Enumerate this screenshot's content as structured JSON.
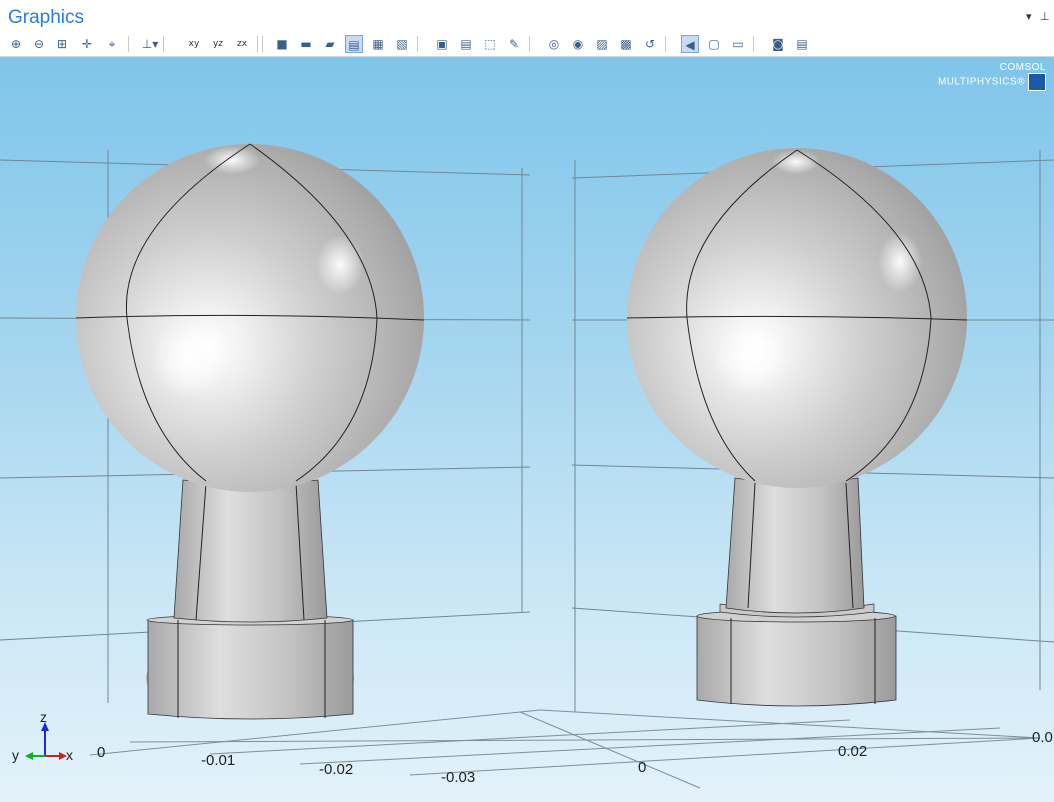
{
  "window": {
    "title": "Graphics",
    "dropdown_glyph": "▾",
    "pin_glyph": "⊥"
  },
  "toolbar": {
    "buttons": [
      {
        "name": "zoom-in-icon"
      },
      {
        "name": "zoom-out-icon"
      },
      {
        "name": "zoom-box-icon"
      },
      {
        "name": "zoom-selected-icon"
      },
      {
        "name": "zoom-extents-icon"
      },
      {
        "name": "views-icon"
      },
      {
        "name": "xy-view-icon",
        "text": "xy"
      },
      {
        "name": "yz-view-icon",
        "text": "yz"
      },
      {
        "name": "zx-view-icon",
        "text": "zx"
      },
      {
        "name": "select-objects-icon"
      },
      {
        "name": "select-domains-icon"
      },
      {
        "name": "select-boundaries-icon"
      },
      {
        "name": "select-edges-icon",
        "active": true
      },
      {
        "name": "select-points-icon"
      },
      {
        "name": "select-none-icon"
      },
      {
        "name": "clear-selection-icon"
      },
      {
        "name": "select-all-icon"
      },
      {
        "name": "select-box-icon"
      },
      {
        "name": "paint-selection-icon"
      },
      {
        "name": "hide-icon"
      },
      {
        "name": "show-icon"
      },
      {
        "name": "view-only-icon"
      },
      {
        "name": "hide-selected-icon"
      },
      {
        "name": "reset-hiding-icon"
      },
      {
        "name": "scene-light-icon",
        "active": true
      },
      {
        "name": "transparency-icon"
      },
      {
        "name": "wireframe-icon"
      },
      {
        "name": "camera-icon"
      },
      {
        "name": "print-icon"
      }
    ]
  },
  "branding": {
    "line1": "COMSOL",
    "line2": "MULTIPHYSICS®"
  },
  "axes": {
    "tick_labels_left": [
      "0",
      "-0.01",
      "-0.02",
      "-0.03"
    ],
    "tick_labels_right": [
      "0",
      "0.02",
      "0.0"
    ],
    "triad": {
      "z": "z",
      "y": "y",
      "x": "x"
    }
  },
  "colors": {
    "accent": "#2a7fd4",
    "active_button": "#c7dcf3"
  }
}
